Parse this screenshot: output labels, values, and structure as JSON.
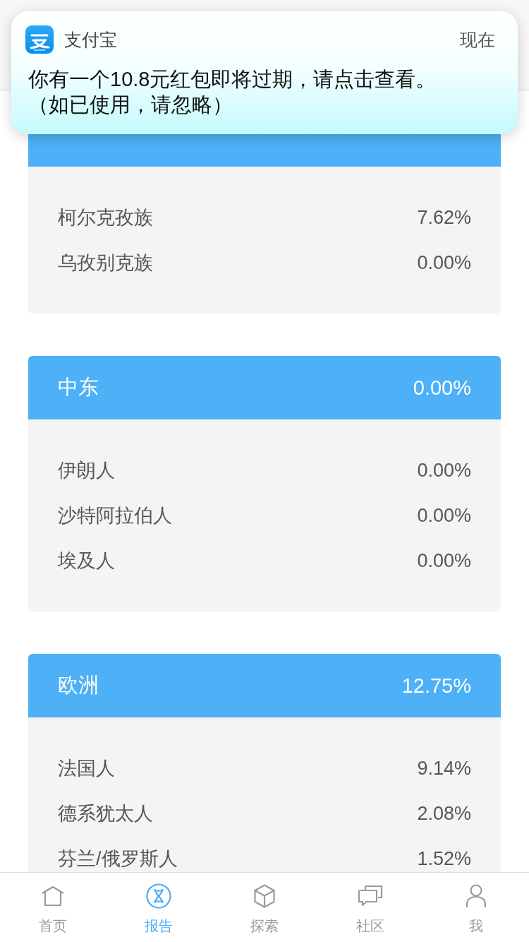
{
  "notification": {
    "app": "支付宝",
    "time": "现在",
    "message_lines": [
      "你有一个10.8元红包即将过期，请点击查看。",
      "（如已使用，请忽略）"
    ]
  },
  "regions": [
    {
      "groups": [
        {
          "name": "柯尔克孜族",
          "share": "7.62%"
        },
        {
          "name": "乌孜别克族",
          "share": "0.00%"
        }
      ]
    },
    {
      "name": "中东",
      "share": "0.00%",
      "groups": [
        {
          "name": "伊朗人",
          "share": "0.00%"
        },
        {
          "name": "沙特阿拉伯人",
          "share": "0.00%"
        },
        {
          "name": "埃及人",
          "share": "0.00%"
        }
      ]
    },
    {
      "name": "欧洲",
      "share": "12.75%",
      "groups": [
        {
          "name": "法国人",
          "share": "9.14%"
        },
        {
          "name": "德系犹太人",
          "share": "2.08%"
        },
        {
          "name": "芬兰/俄罗斯人",
          "share": "1.52%"
        }
      ]
    }
  ],
  "tab_bar": [
    {
      "label": "首页",
      "selected": false
    },
    {
      "label": "报告",
      "selected": true
    },
    {
      "label": "探索",
      "selected": false
    },
    {
      "label": "社区",
      "selected": false
    },
    {
      "label": "我",
      "selected": false
    }
  ]
}
